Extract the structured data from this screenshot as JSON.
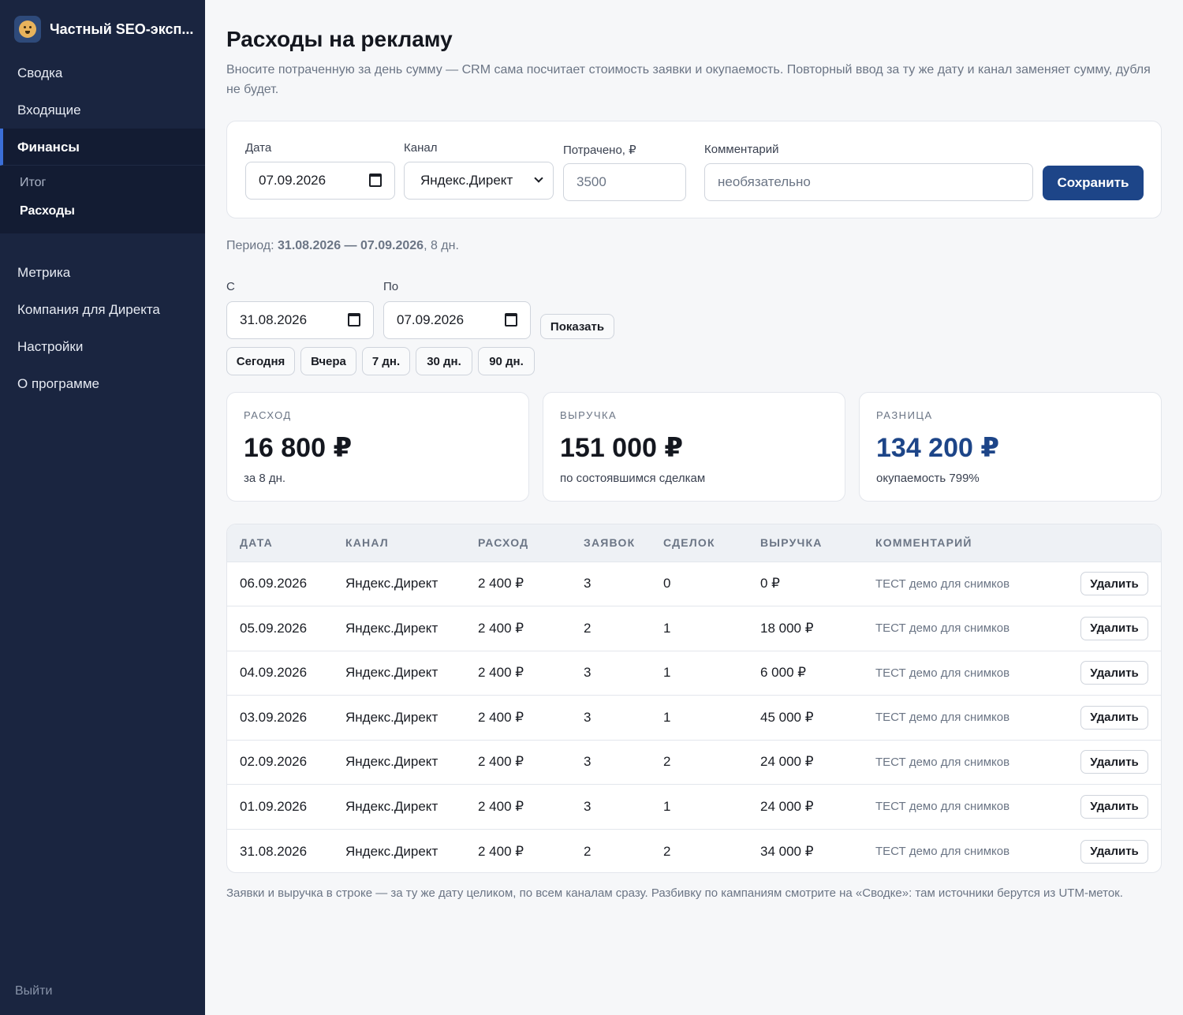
{
  "app": {
    "name": "Частный SEO-эксп..."
  },
  "nav": {
    "items": [
      {
        "label": "Сводка"
      },
      {
        "label": "Входящие"
      },
      {
        "label": "Финансы"
      }
    ],
    "finance_sub": [
      {
        "label": "Итог"
      },
      {
        "label": "Расходы"
      }
    ],
    "lower": [
      {
        "label": "Метрика"
      },
      {
        "label": "Компания для Директа"
      },
      {
        "label": "Настройки"
      },
      {
        "label": "О программе"
      }
    ],
    "logout": "Выйти"
  },
  "page": {
    "title": "Расходы на рекламу",
    "description": "Вносите потраченную за день сумму — CRM сама посчитает стоимость заявки и окупаемость. Повторный ввод за ту же дату и канал заменяет сумму, дубля не будет."
  },
  "form": {
    "date_label": "Дата",
    "date_value": "07.09.2026",
    "channel_label": "Канал",
    "channel_value": "Яндекс.Директ",
    "spent_label": "Потрачено, ₽",
    "spent_placeholder": "3500",
    "comment_label": "Комментарий",
    "comment_placeholder": "необязательно",
    "save_label": "Сохранить"
  },
  "period": {
    "prefix": "Период: ",
    "range": "31.08.2026 — 07.09.2026",
    "suffix": ", 8 дн."
  },
  "filter": {
    "from_label": "С",
    "from_value": "31.08.2026",
    "to_label": "По",
    "to_value": "07.09.2026",
    "show_label": "Показать",
    "presets": [
      "Сегодня",
      "Вчера",
      "7 дн.",
      "30 дн.",
      "90 дн."
    ]
  },
  "stats": [
    {
      "label": "РАСХОД",
      "value": "16 800 ₽",
      "sub": "за 8 дн."
    },
    {
      "label": "ВЫРУЧКА",
      "value": "151 000 ₽",
      "sub": "по состоявшимся сделкам"
    },
    {
      "label": "РАЗНИЦА",
      "value": "134 200 ₽",
      "sub": "окупаемость 799%"
    }
  ],
  "table": {
    "headers": [
      "ДАТА",
      "КАНАЛ",
      "РАСХОД",
      "ЗАЯВОК",
      "СДЕЛОК",
      "ВЫРУЧКА",
      "КОММЕНТАРИЙ"
    ],
    "delete_label": "Удалить",
    "rows": [
      {
        "date": "06.09.2026",
        "channel": "Яндекс.Директ",
        "spend": "2 400 ₽",
        "leads": "3",
        "deals": "0",
        "revenue": "0 ₽",
        "comment": "ТЕСТ демо для снимков"
      },
      {
        "date": "05.09.2026",
        "channel": "Яндекс.Директ",
        "spend": "2 400 ₽",
        "leads": "2",
        "deals": "1",
        "revenue": "18 000 ₽",
        "comment": "ТЕСТ демо для снимков"
      },
      {
        "date": "04.09.2026",
        "channel": "Яндекс.Директ",
        "spend": "2 400 ₽",
        "leads": "3",
        "deals": "1",
        "revenue": "6 000 ₽",
        "comment": "ТЕСТ демо для снимков"
      },
      {
        "date": "03.09.2026",
        "channel": "Яндекс.Директ",
        "spend": "2 400 ₽",
        "leads": "3",
        "deals": "1",
        "revenue": "45 000 ₽",
        "comment": "ТЕСТ демо для снимков"
      },
      {
        "date": "02.09.2026",
        "channel": "Яндекс.Директ",
        "spend": "2 400 ₽",
        "leads": "3",
        "deals": "2",
        "revenue": "24 000 ₽",
        "comment": "ТЕСТ демо для снимков"
      },
      {
        "date": "01.09.2026",
        "channel": "Яндекс.Директ",
        "spend": "2 400 ₽",
        "leads": "3",
        "deals": "1",
        "revenue": "24 000 ₽",
        "comment": "ТЕСТ демо для снимков"
      },
      {
        "date": "31.08.2026",
        "channel": "Яндекс.Директ",
        "spend": "2 400 ₽",
        "leads": "2",
        "deals": "2",
        "revenue": "34 000 ₽",
        "comment": "ТЕСТ демо для снимков"
      }
    ]
  },
  "footnote": "Заявки и выручка в строке — за ту же дату целиком, по всем каналам сразу. Разбивку по кампаниям смотрите на «Сводке»: там источники берутся из UTM-меток.",
  "colors": {
    "sidebar": "#1a2540",
    "accent": "#1d4588",
    "active_marker": "#3b6fd8"
  },
  "icons": {
    "brand": "dog-logo-icon",
    "date": "calendar-icon",
    "select": "chevron-down-icon"
  }
}
